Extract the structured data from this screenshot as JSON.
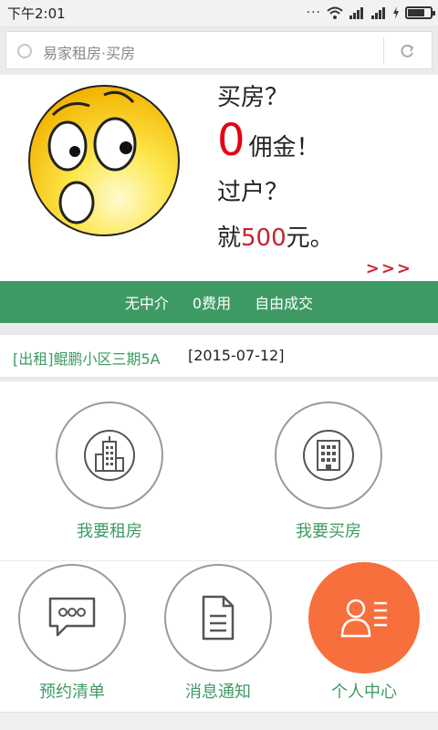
{
  "status_bar": {
    "time": "下午2:01",
    "dots": "···"
  },
  "search": {
    "placeholder_text": "易家租房·买房"
  },
  "banner": {
    "line1": "买房？",
    "line2_zero": "0",
    "line2_rest": "佣金！",
    "line3": "过户？",
    "line4_prefix": "就",
    "line4_amount": "500",
    "line4_suffix": "元。",
    "arrows": ">>>"
  },
  "promo_strip": {
    "items": [
      "无中介",
      "0费用",
      "自由成交"
    ]
  },
  "news": {
    "title": "[出租]鲲鹏小区三期5A",
    "date": "[2015-07-12]"
  },
  "menu": {
    "rent": "我要租房",
    "buy": "我要买房",
    "appointments": "预约清单",
    "notifications": "消息通知",
    "profile": "个人中心"
  },
  "colors": {
    "accent_green": "#3e9a64",
    "accent_orange": "#f76f3c",
    "accent_red": "#e60012"
  }
}
